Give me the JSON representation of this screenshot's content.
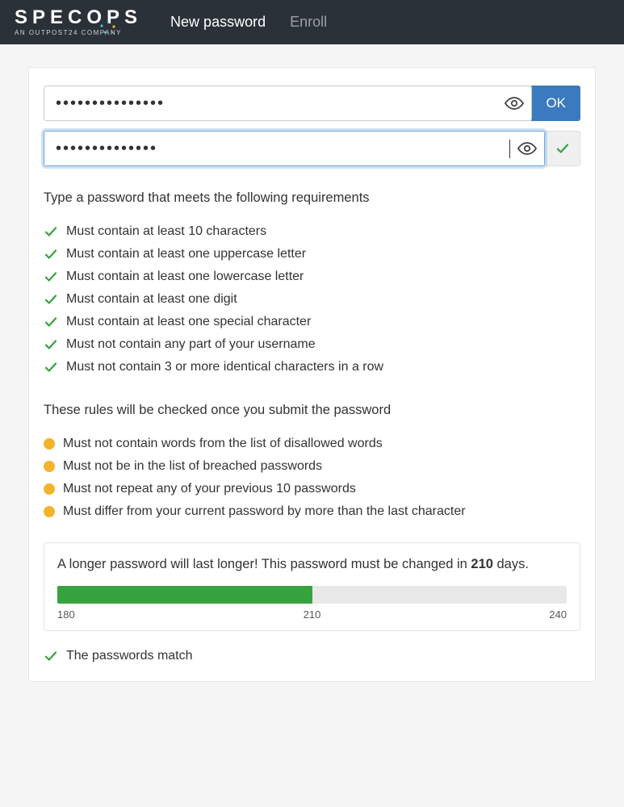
{
  "header": {
    "logo_main": "SPECOPS",
    "logo_sub": "AN OUTPOST24 COMPANY",
    "nav": {
      "new_password": "New password",
      "enroll": "Enroll"
    }
  },
  "inputs": {
    "password1_value": "•••••••••••••••",
    "password2_value": "••••••••••••••",
    "ok_label": "OK"
  },
  "requirements": {
    "title": "Type a password that meets the following requirements",
    "rules": [
      "Must contain at least 10 characters",
      "Must contain at least one uppercase letter",
      "Must contain at least one lowercase letter",
      "Must contain at least one digit",
      "Must contain at least one special character",
      "Must not contain any part of your username",
      "Must not contain 3 or more identical characters in a row"
    ]
  },
  "pending": {
    "title": "These rules will be checked once you submit the password",
    "rules": [
      "Must not contain words from the list of disallowed words",
      "Must not be in the list of breached passwords",
      "Must not repeat any of your previous 10 passwords",
      "Must differ from your current password by more than the last character"
    ]
  },
  "expiry": {
    "prefix": "A longer password will last longer! This password must be changed in ",
    "days": "210",
    "suffix": " days.",
    "min": "180",
    "mid": "210",
    "max": "240",
    "fill_percent": 50
  },
  "match": {
    "label": "The passwords match"
  }
}
